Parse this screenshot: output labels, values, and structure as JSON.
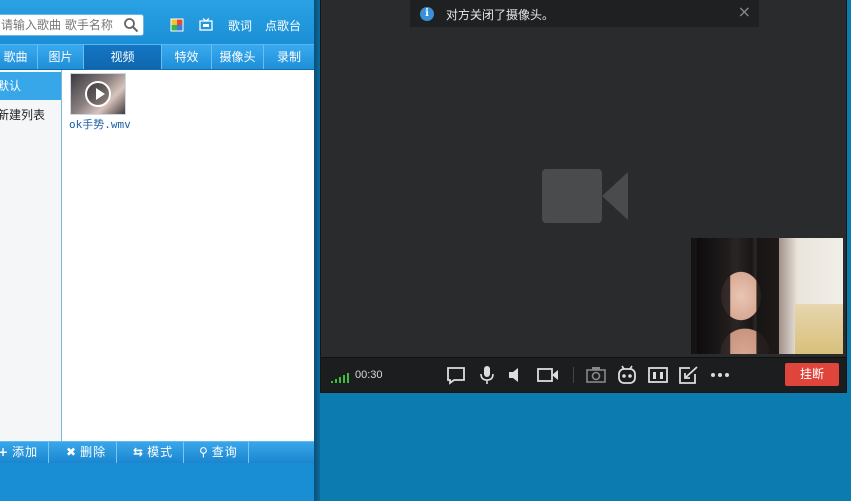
{
  "left_panel": {
    "search": {
      "placeholder": "请输入歌曲 歌手名称"
    },
    "top_links": {
      "lyrics": "歌词",
      "request_song": "点歌台"
    },
    "tabs": [
      {
        "label": "歌曲",
        "active": false
      },
      {
        "label": "图片",
        "active": false
      },
      {
        "label": "视频",
        "active": true
      },
      {
        "label": "特效",
        "active": false
      },
      {
        "label": "摄像头",
        "active": false
      },
      {
        "label": "录制",
        "active": false
      }
    ],
    "lists": [
      {
        "label": "默认",
        "selected": true
      },
      {
        "label": "新建列表",
        "selected": false
      }
    ],
    "videos": [
      {
        "name": "ok手势.wmv",
        "icon": "play-icon"
      }
    ],
    "bottom_buttons": [
      {
        "glyph": "+",
        "label": "添加",
        "icon": "plus-icon"
      },
      {
        "glyph": "✖",
        "label": "删除",
        "icon": "close-icon"
      },
      {
        "glyph": "⇆",
        "label": "模式",
        "icon": "loop-icon"
      },
      {
        "glyph": "⚲",
        "label": "查询",
        "icon": "search-icon"
      }
    ],
    "colors": {
      "panel": "#1a8ed4",
      "tab_active": "#1476c4",
      "selected_row": "#37a7ea"
    }
  },
  "call_window": {
    "notice": {
      "text": "对方关闭了摄像头。",
      "icon": "info-icon",
      "close": "×"
    },
    "remote_video": {
      "state": "camera-off",
      "icon": "video-camera-icon"
    },
    "self_view": {
      "state": "live"
    },
    "controls": {
      "duration": "00:30",
      "signal_icon": "signal-strength-icon",
      "buttons": [
        "chat-icon",
        "microphone-icon",
        "speaker-icon",
        "camera-icon",
        "snapshot-icon",
        "robot-face-icon",
        "layout-icon",
        "share-screen-icon",
        "more-icon"
      ],
      "hangup_label": "挂断"
    },
    "colors": {
      "background": "#2a2b2d",
      "hangup": "#e0453c",
      "signal": "#3cc03c"
    }
  }
}
